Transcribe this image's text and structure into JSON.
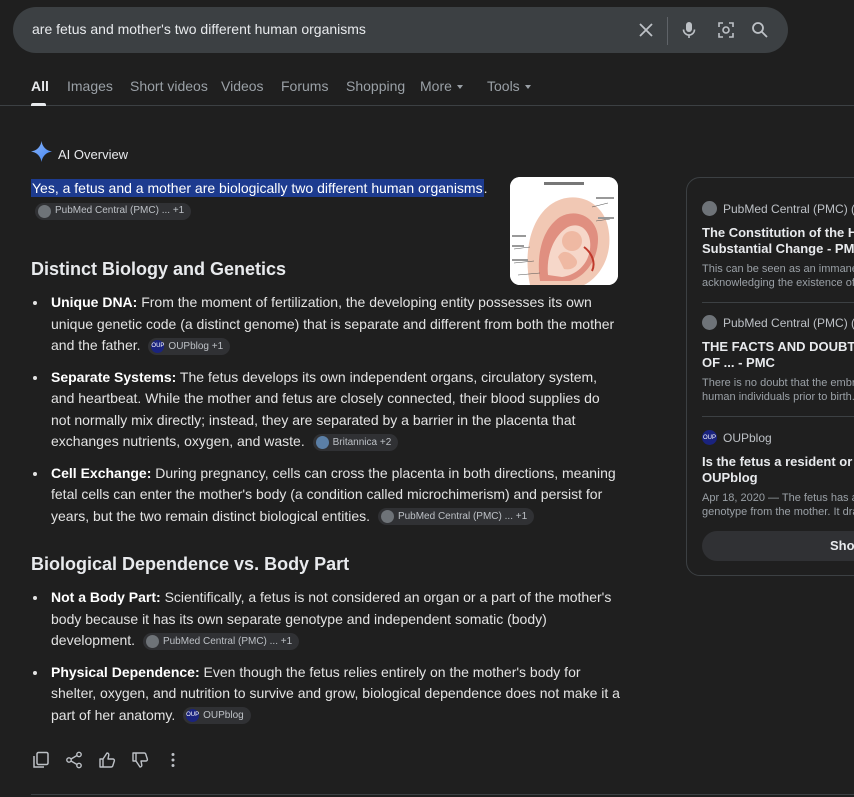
{
  "search": {
    "query": "are fetus and mother's two different human organisms"
  },
  "tabs": [
    {
      "label": "All"
    },
    {
      "label": "Images"
    },
    {
      "label": "Short videos"
    },
    {
      "label": "Videos"
    },
    {
      "label": "Forums"
    },
    {
      "label": "Shopping"
    },
    {
      "label": "More"
    },
    {
      "label": "Tools"
    }
  ],
  "overview": {
    "title": "AI Overview",
    "lead_highlight": "Yes, a fetus and a mother are biologically two different human organisms",
    "lead_end": ".",
    "lead_chip": "PubMed Central (PMC) ... +1",
    "sections": [
      {
        "heading": "Distinct Biology and Genetics",
        "bullets": [
          {
            "term": "Unique DNA:",
            "text": " From the moment of fertilization, the developing entity possesses its own unique genetic code (a distinct genome) that is separate and different from both the mother and the father.",
            "chip": "OUPblog +1"
          },
          {
            "term": "Separate Systems:",
            "text": " The fetus develops its own independent organs, circulatory system, and heartbeat. While the mother and fetus are closely connected, their blood supplies do not normally mix directly; instead, they are separated by a barrier in the placenta that exchanges nutrients, oxygen, and waste.",
            "chip": "Britannica +2"
          },
          {
            "term": "Cell Exchange:",
            "text": " During pregnancy, cells can cross the placenta in both directions, meaning fetal cells can enter the mother's body (a condition called microchimerism) and persist for years, but the two remain distinct biological entities.",
            "chip": "PubMed Central (PMC) ... +1"
          }
        ]
      },
      {
        "heading": "Biological Dependence vs. Body Part",
        "bullets": [
          {
            "term": "Not a Body Part:",
            "text": " Scientifically, a fetus is not considered an organ or a part of the mother's body because it has its own separate genotype and independent somatic (body) development.",
            "chip": "PubMed Central (PMC) ... +1"
          },
          {
            "term": "Physical Dependence:",
            "text": " Even though the fetus relies entirely on the mother's body for shelter, oxygen, and nutrition to survive and grow, biological dependence does not make it a part of her anatomy.",
            "chip": "OUPblog"
          }
        ]
      }
    ]
  },
  "sources": [
    {
      "site": "PubMed Central (PMC) (.go",
      "title1": "The Constitution of the Hum",
      "title2": "Substantial Change - PMC",
      "snippet1": "This can be seen as an immane",
      "snippet2": "acknowledging the existence of"
    },
    {
      "site": "PubMed Central (PMC) (.go",
      "title1": "THE FACTS AND DOUBTS",
      "title2": "OF ... - PMC",
      "snippet1": "There is no doubt that the embr",
      "snippet2": "human individuals prior to birth."
    },
    {
      "site": "OUPblog",
      "title1": "Is the fetus a resident or a b",
      "title2": "OUPblog",
      "snippet1": "Apr 18, 2020 — The fetus has a",
      "snippet2": "genotype from the mother. It dra"
    }
  ],
  "show_all_label": "Show",
  "colors": {
    "highlight": "#1d3b8f",
    "background": "#1f1f1f",
    "oup_badge": "#1a237e"
  }
}
